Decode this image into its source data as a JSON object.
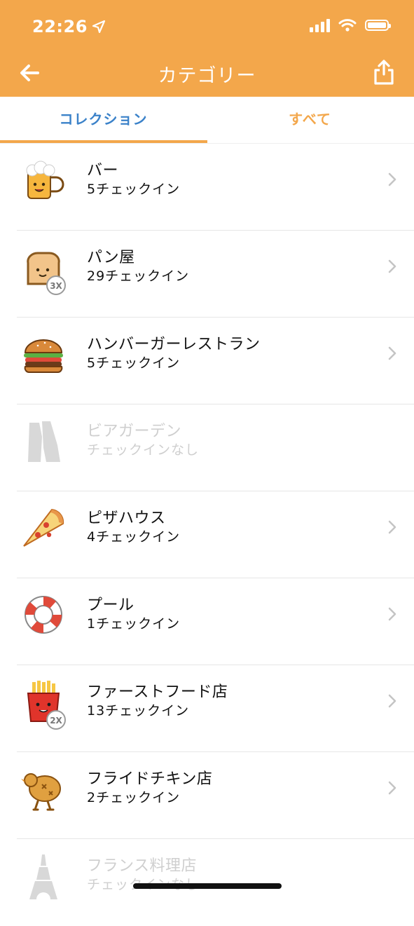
{
  "status_bar": {
    "time": "22:26"
  },
  "nav": {
    "title": "カテゴリー"
  },
  "tabs": [
    {
      "label": "コレクション",
      "active": true
    },
    {
      "label": "すべて",
      "active": false
    }
  ],
  "colors": {
    "header": "#F3A74B",
    "active_tab": "#3B82C9",
    "inactive_tab": "#F3A74B"
  },
  "categories": [
    {
      "name": "バー",
      "count": "5チェックイン",
      "icon": "beer-mug-icon",
      "badge": ""
    },
    {
      "name": "パン屋",
      "count": "29チェックイン",
      "icon": "toast-icon",
      "badge": "3X"
    },
    {
      "name": "ハンバーガーレストラン",
      "count": "5チェックイン",
      "icon": "burger-icon",
      "badge": ""
    },
    {
      "name": "ビアガーデン",
      "count": "チェックインなし",
      "icon": "beer-garden-icon",
      "badge": ""
    },
    {
      "name": "ピザハウス",
      "count": "4チェックイン",
      "icon": "pizza-icon",
      "badge": ""
    },
    {
      "name": "プール",
      "count": "1チェックイン",
      "icon": "lifebuoy-icon",
      "badge": ""
    },
    {
      "name": "ファーストフード店",
      "count": "13チェックイン",
      "icon": "fries-icon",
      "badge": "2X"
    },
    {
      "name": "フライドチキン店",
      "count": "2チェックイン",
      "icon": "fried-chicken-icon",
      "badge": ""
    },
    {
      "name": "フランス料理店",
      "count": "チェックインなし",
      "icon": "eiffel-tower-icon",
      "badge": ""
    }
  ]
}
